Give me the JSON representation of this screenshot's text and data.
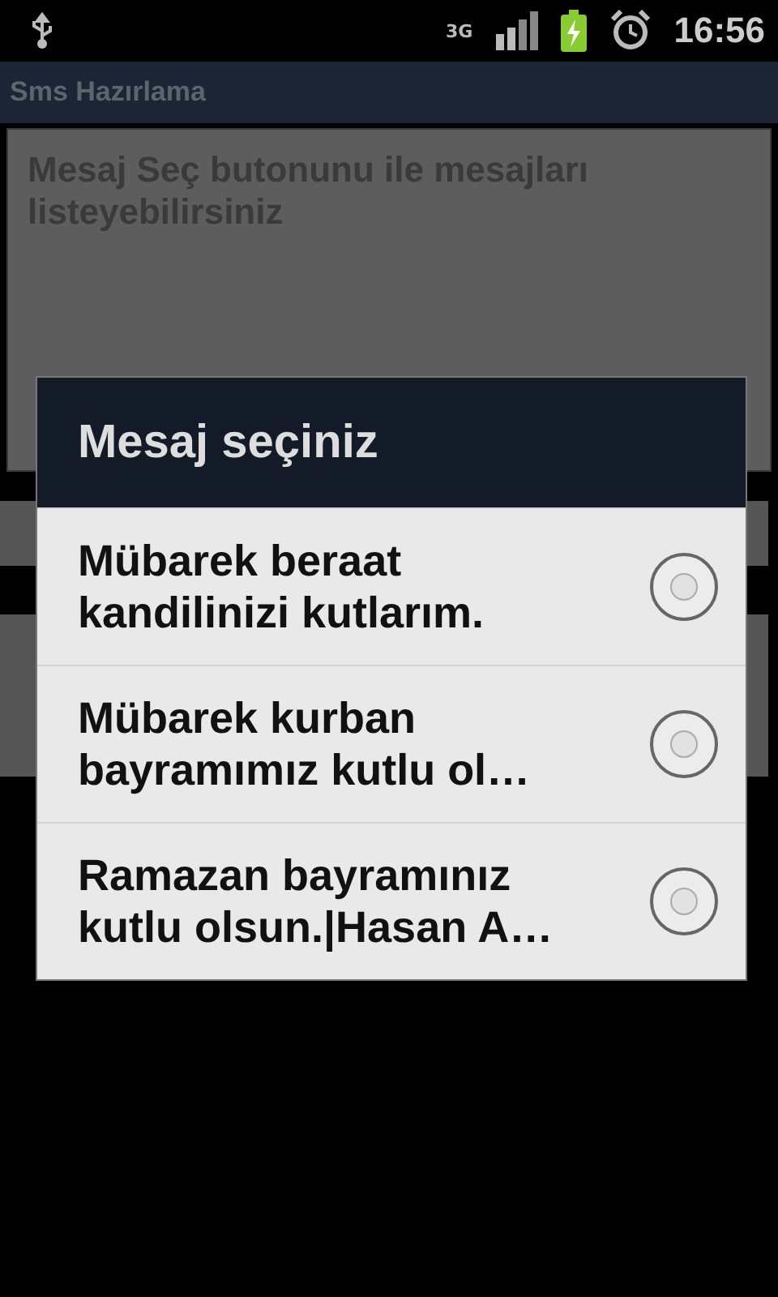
{
  "status_bar": {
    "network": "3G",
    "time": "16:56"
  },
  "title_bar": {
    "title": "Sms Hazırlama"
  },
  "message_field": {
    "placeholder": "Mesaj Seç butonunu ile mesajları listeyebilirsiniz"
  },
  "dialog": {
    "title": "Mesaj seçiniz",
    "items": [
      {
        "label": "Mübarek beraat kandilinizi kutlarım.",
        "selected": false
      },
      {
        "label": "Mübarek kurban bayramımız kutlu ol…",
        "selected": false
      },
      {
        "label": "Ramazan bayramınız kutlu olsun.|Hasan A…",
        "selected": false
      }
    ]
  }
}
